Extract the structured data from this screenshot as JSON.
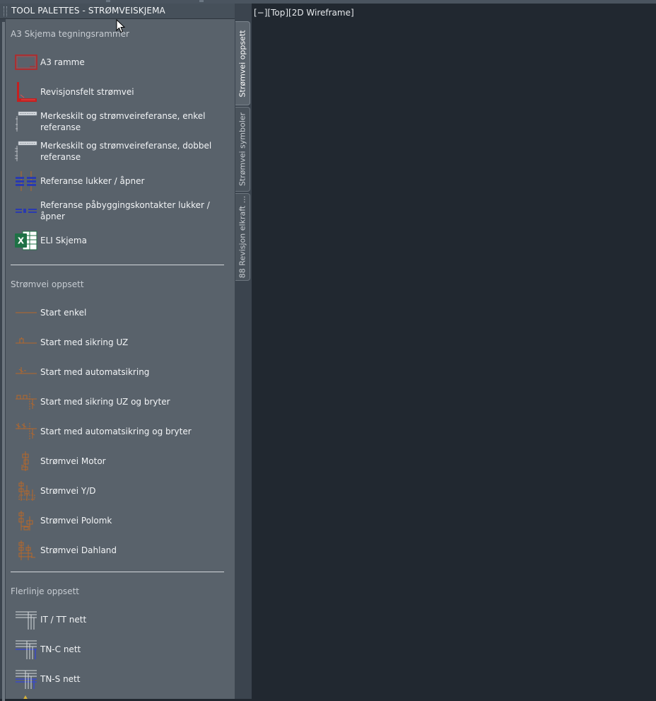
{
  "palette": {
    "title": "TOOL PALETTES - STRØMVEISKJEMA",
    "tabs": [
      {
        "label": "Strømvei oppsett",
        "active": true
      },
      {
        "label": "Strømvei symboler",
        "active": false
      },
      {
        "label": "88 Revisjon elkraft ...",
        "active": false
      }
    ],
    "sections": [
      {
        "title": "A3 Skjema tegningsrammer",
        "items": [
          {
            "label": "A3 ramme",
            "icon": "a3-frame-icon"
          },
          {
            "label": "Revisjonsfelt strømvei",
            "icon": "revision-field-icon"
          },
          {
            "label": "Merkeskilt og strømveireferanse, enkel referanse",
            "icon": "marker-single-ref-icon"
          },
          {
            "label": "Merkeskilt og strømveireferanse, dobbel referanse",
            "icon": "marker-double-ref-icon"
          },
          {
            "label": "Referanse lukker / åpner",
            "icon": "reference-close-open-icon"
          },
          {
            "label": "Referanse påbyggingskontakter lukker / åpner",
            "icon": "reference-aux-contacts-icon"
          },
          {
            "label": "ELI Skjema",
            "icon": "excel-icon"
          }
        ]
      },
      {
        "title": "Strømvei oppsett",
        "items": [
          {
            "label": "Start enkel",
            "icon": "start-simple-icon"
          },
          {
            "label": "Start med sikring UZ",
            "icon": "start-fuse-uz-icon"
          },
          {
            "label": "Start med automatsikring",
            "icon": "start-breaker-icon"
          },
          {
            "label": "Start med sikring UZ og bryter",
            "icon": "start-fuse-uz-switch-icon"
          },
          {
            "label": "Start med automatsikring og bryter",
            "icon": "start-breaker-switch-icon"
          },
          {
            "label": "Strømvei Motor",
            "icon": "circuit-motor-icon"
          },
          {
            "label": "Strømvei Y/D",
            "icon": "circuit-star-delta-icon"
          },
          {
            "label": "Strømvei Polomk",
            "icon": "circuit-pole-change-icon"
          },
          {
            "label": "Strømvei Dahland",
            "icon": "circuit-dahlander-icon"
          }
        ]
      },
      {
        "title": "Flerlinje oppsett",
        "items": [
          {
            "label": "IT / TT nett",
            "icon": "it-tt-network-icon"
          },
          {
            "label": "TN-C nett",
            "icon": "tn-c-network-icon"
          },
          {
            "label": "TN-S nett",
            "icon": "tn-s-network-icon"
          }
        ]
      }
    ]
  },
  "viewport": {
    "label": "[−][Top][2D Wireframe]"
  },
  "colors": {
    "background": "#212830",
    "palette_content": "#59626b",
    "titlebar": "#46505a",
    "red_symbol": "#c42020",
    "orange_symbol": "#b8682a",
    "blue_symbol": "#2a3ab0",
    "excel_green": "#1e7145"
  }
}
